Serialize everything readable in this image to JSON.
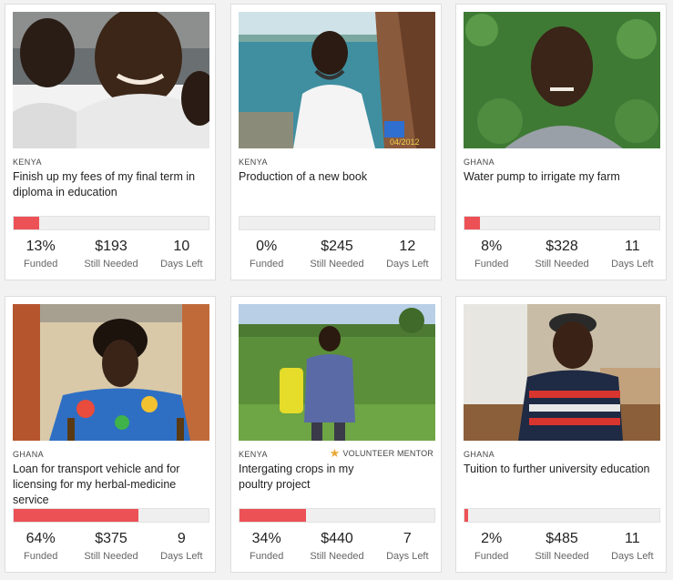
{
  "projects": [
    {
      "country": "KENYA",
      "title": "Finish up my fees of my final term in diploma in education",
      "funded": "13%",
      "funded_fraction": 0.13,
      "needed": "$193",
      "days": "10",
      "labels": {
        "funded": "Funded",
        "needed": "Still Needed",
        "days": "Days Left"
      }
    },
    {
      "country": "KENYA",
      "title": "Production of a new book",
      "funded": "0%",
      "funded_fraction": 0.0,
      "needed": "$245",
      "days": "12",
      "photo_caption": "04/2012",
      "labels": {
        "funded": "Funded",
        "needed": "Still Needed",
        "days": "Days Left"
      }
    },
    {
      "country": "GHANA",
      "title": "Water pump to irrigate my farm",
      "funded": "8%",
      "funded_fraction": 0.08,
      "needed": "$328",
      "days": "11",
      "labels": {
        "funded": "Funded",
        "needed": "Still Needed",
        "days": "Days Left"
      }
    },
    {
      "country": "GHANA",
      "title": "Loan for transport vehicle and for licensing for my herbal-medicine service",
      "funded": "64%",
      "funded_fraction": 0.64,
      "needed": "$375",
      "days": "9",
      "labels": {
        "funded": "Funded",
        "needed": "Still Needed",
        "days": "Days Left"
      }
    },
    {
      "country": "KENYA",
      "badge": "VOLUNTEER MENTOR",
      "title": "Intergating crops in my poultry project",
      "funded": "34%",
      "funded_fraction": 0.34,
      "needed": "$440",
      "days": "7",
      "labels": {
        "funded": "Funded",
        "needed": "Still Needed",
        "days": "Days Left"
      }
    },
    {
      "country": "GHANA",
      "title": "Tuition to further university education",
      "funded": "2%",
      "funded_fraction": 0.02,
      "needed": "$485",
      "days": "11",
      "labels": {
        "funded": "Funded",
        "needed": "Still Needed",
        "days": "Days Left"
      }
    }
  ],
  "colors": {
    "progress": "#ec5156",
    "track": "#efefef",
    "star": "#e8a93a"
  },
  "icons": {
    "mentor_badge": "star-icon"
  }
}
